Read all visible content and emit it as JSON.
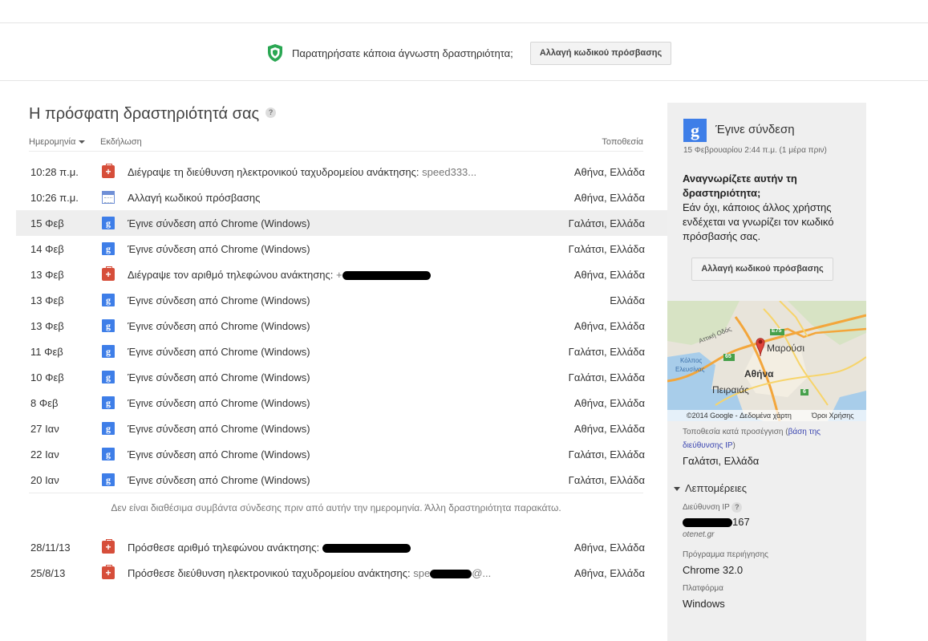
{
  "banner": {
    "message": "Παρατηρήσατε κάποια άγνωστη δραστηριότητα;",
    "button": "Αλλαγή κωδικού πρόσβασης"
  },
  "main": {
    "title": "Η πρόσφατη δραστηριότητά σας",
    "help": "?",
    "headers": {
      "date": "Ημερομηνία",
      "event": "Εκδήλωση",
      "location": "Τοποθεσία"
    },
    "rows": [
      {
        "date": "10:28 π.μ.",
        "icon": "security-kit-icon",
        "event": "Διέγραψε τη διεύθυνση ηλεκτρονικού ταχυδρομείου ανάκτησης:",
        "extra": "speed333...",
        "location": "Αθήνα, Ελλάδα"
      },
      {
        "date": "10:26 π.μ.",
        "icon": "calendar-icon",
        "event": "Αλλαγή κωδικού πρόσβασης",
        "extra": "",
        "location": "Αθήνα, Ελλάδα"
      },
      {
        "date": "15 Φεβ",
        "icon": "google-icon",
        "event": "Έγινε σύνδεση από Chrome (Windows)",
        "extra": "",
        "location": "Γαλάτσι, Ελλάδα",
        "selected": true
      },
      {
        "date": "14 Φεβ",
        "icon": "google-icon",
        "event": "Έγινε σύνδεση από Chrome (Windows)",
        "extra": "",
        "location": "Γαλάτσι, Ελλάδα"
      },
      {
        "date": "13 Φεβ",
        "icon": "security-kit-icon",
        "event": "Διέγραψε τον αριθμό τηλεφώνου ανάκτησης:",
        "extra": "+",
        "location": "Αθήνα, Ελλάδα",
        "redacted": true
      },
      {
        "date": "13 Φεβ",
        "icon": "google-icon",
        "event": "Έγινε σύνδεση από Chrome (Windows)",
        "extra": "",
        "location": "Ελλάδα"
      },
      {
        "date": "13 Φεβ",
        "icon": "google-icon",
        "event": "Έγινε σύνδεση από Chrome (Windows)",
        "extra": "",
        "location": "Αθήνα, Ελλάδα"
      },
      {
        "date": "11 Φεβ",
        "icon": "google-icon",
        "event": "Έγινε σύνδεση από Chrome (Windows)",
        "extra": "",
        "location": "Γαλάτσι, Ελλάδα"
      },
      {
        "date": "10 Φεβ",
        "icon": "google-icon",
        "event": "Έγινε σύνδεση από Chrome (Windows)",
        "extra": "",
        "location": "Γαλάτσι, Ελλάδα"
      },
      {
        "date": "8 Φεβ",
        "icon": "google-icon",
        "event": "Έγινε σύνδεση από Chrome (Windows)",
        "extra": "",
        "location": "Αθήνα, Ελλάδα"
      },
      {
        "date": "27 Ιαν",
        "icon": "google-icon",
        "event": "Έγινε σύνδεση από Chrome (Windows)",
        "extra": "",
        "location": "Αθήνα, Ελλάδα"
      },
      {
        "date": "22 Ιαν",
        "icon": "google-icon",
        "event": "Έγινε σύνδεση από Chrome (Windows)",
        "extra": "",
        "location": "Γαλάτσι, Ελλάδα"
      },
      {
        "date": "20 Ιαν",
        "icon": "google-icon",
        "event": "Έγινε σύνδεση από Chrome (Windows)",
        "extra": "",
        "location": "Γαλάτσι, Ελλάδα"
      }
    ],
    "note": "Δεν είναι διαθέσιμα συμβάντα σύνδεσης πριν από αυτήν την ημερομηνία. Άλλη δραστηριότητα παρακάτω.",
    "older_rows": [
      {
        "date": "28/11/13",
        "icon": "security-kit-icon",
        "event": "Πρόσθεσε αριθμό τηλεφώνου ανάκτησης:",
        "extra": "",
        "location": "Αθήνα, Ελλάδα",
        "redacted": true
      },
      {
        "date": "25/8/13",
        "icon": "security-kit-icon",
        "event": "Πρόσθεσε διεύθυνση ηλεκτρονικού ταχυδρομείου ανάκτησης:",
        "extra": "spe",
        "extra_tail": "@...",
        "location": "Αθήνα, Ελλάδα",
        "redacted": true
      }
    ]
  },
  "panel": {
    "logo": "g",
    "title": "Έγινε σύνδεση",
    "time": "15 Φεβρουαρίου 2:44 π.μ. (1 μέρα πριν)",
    "question_bold": "Αναγνωρίζετε αυτήν τη δραστηριότητα;",
    "question_text": "Εάν όχι, κάποιος άλλος χρήστης ενδέχεται να γνωρίζει τον κωδικό πρόσβασής σας.",
    "button": "Αλλαγή κωδικού πρόσβασης",
    "map": {
      "labels": {
        "athens": "Αθήνα",
        "piraeus": "Πειραιάς",
        "marousi": "Μαρούσι",
        "attiki_odos": "Αττική Οδός",
        "kolpos": "Κόλπος",
        "elefsinas": "Ελευσίνας",
        "e75": "E75",
        "r65": "65",
        "r6": "6"
      },
      "copyright": "©2014 Google - Δεδομένα χάρτη",
      "terms": "Όροι Χρήσης"
    },
    "approx_prefix": "Τοποθεσία κατά προσέγγιση (",
    "approx_link": "βάση της διεύθυνσης IP",
    "approx_suffix": ")",
    "city": "Γαλάτσι, Ελλάδα",
    "details": "Λεπτομέρειες",
    "ip_label": "Διεύθυνση IP",
    "ip_suffix": "167",
    "host": "otenet.gr",
    "browser_label": "Πρόγραμμα περιήγησης",
    "browser": "Chrome 32.0",
    "platform_label": "Πλατφόρμα",
    "platform": "Windows"
  },
  "colors": {
    "google_blue": "#3e7ee8",
    "kit_red": "#d64e3a",
    "shield_green": "#2aa753",
    "link": "#3a45b0",
    "panel_bg": "#efefef"
  }
}
